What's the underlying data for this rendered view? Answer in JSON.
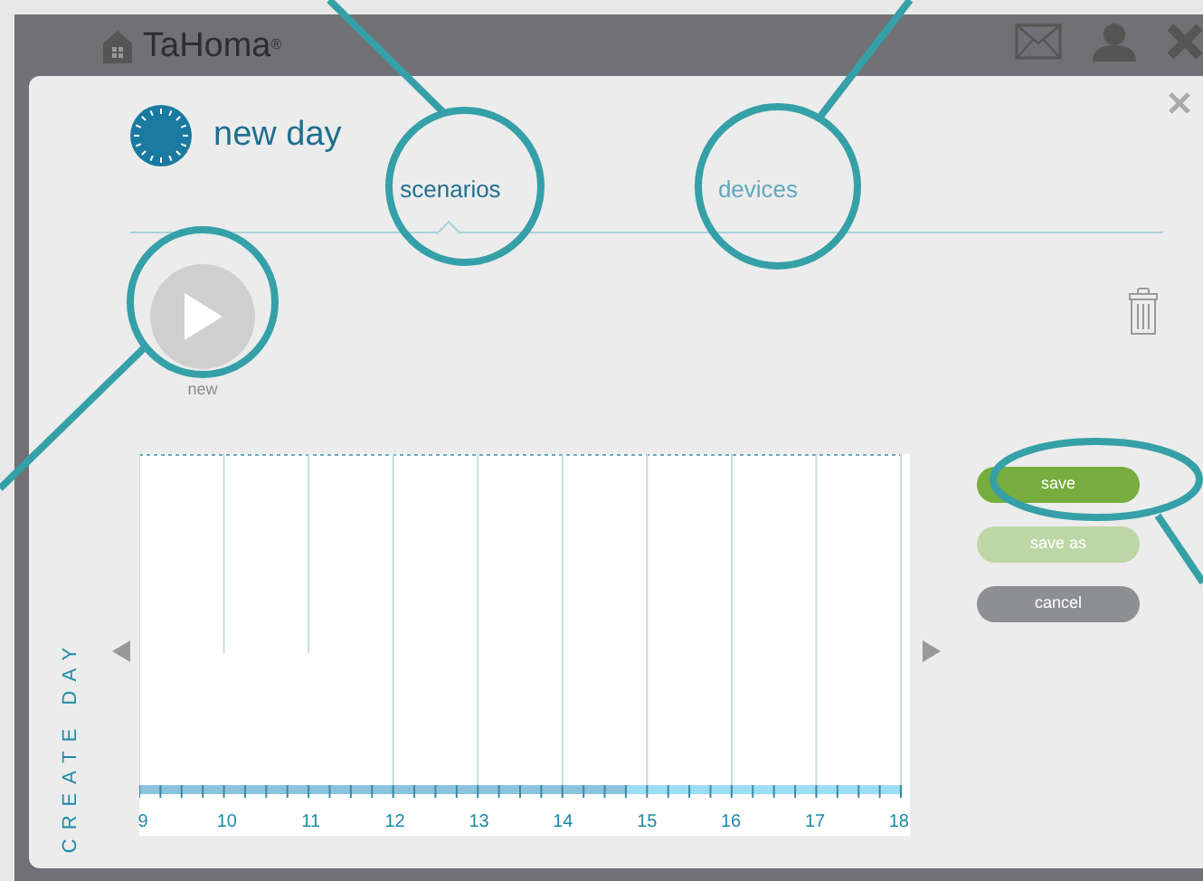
{
  "app": {
    "logo": "TaHoma",
    "mark": "®"
  },
  "dialog": {
    "title": "new day"
  },
  "tabs": [
    {
      "label": "scenarios",
      "selected": true
    },
    {
      "label": "devices",
      "selected": false
    }
  ],
  "new_scenario": {
    "label": "new"
  },
  "side_label": "CREATE DAY",
  "timeline": {
    "hours": [
      "9",
      "10",
      "11",
      "12",
      "13",
      "14",
      "15",
      "16",
      "17",
      "18"
    ]
  },
  "buttons": [
    {
      "label": "save",
      "kind": "primary",
      "disabled": false
    },
    {
      "label": "save as",
      "kind": "primary",
      "disabled": true
    },
    {
      "label": "cancel",
      "kind": "secondary",
      "disabled": false
    }
  ]
}
